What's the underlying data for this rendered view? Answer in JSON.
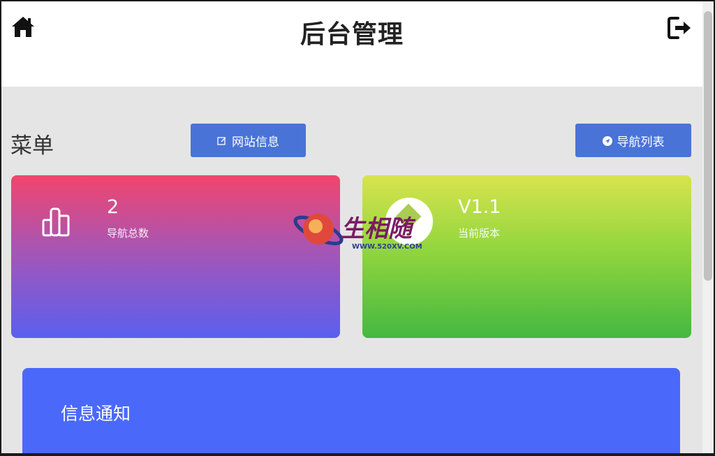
{
  "header": {
    "title": "后台管理",
    "home_icon": "home-icon",
    "logout_icon": "logout-icon"
  },
  "menu": {
    "title": "菜单",
    "buttons": [
      {
        "label": "网站信息",
        "icon": "edit-icon"
      },
      {
        "label": "导航列表",
        "icon": "compass-icon"
      }
    ]
  },
  "cards": [
    {
      "value": "2",
      "label": "导航总数",
      "icon": "bar-chart-icon"
    },
    {
      "value": "V1.1",
      "label": "当前版本",
      "icon": "version-icon"
    }
  ],
  "notice": {
    "title": "信息通知"
  },
  "watermark": {
    "text": "生相随",
    "url": "WWW.520XV.COM"
  },
  "colors": {
    "button": "#4a73d8",
    "notice": "#4a69fb",
    "background": "#e5e5e5"
  }
}
